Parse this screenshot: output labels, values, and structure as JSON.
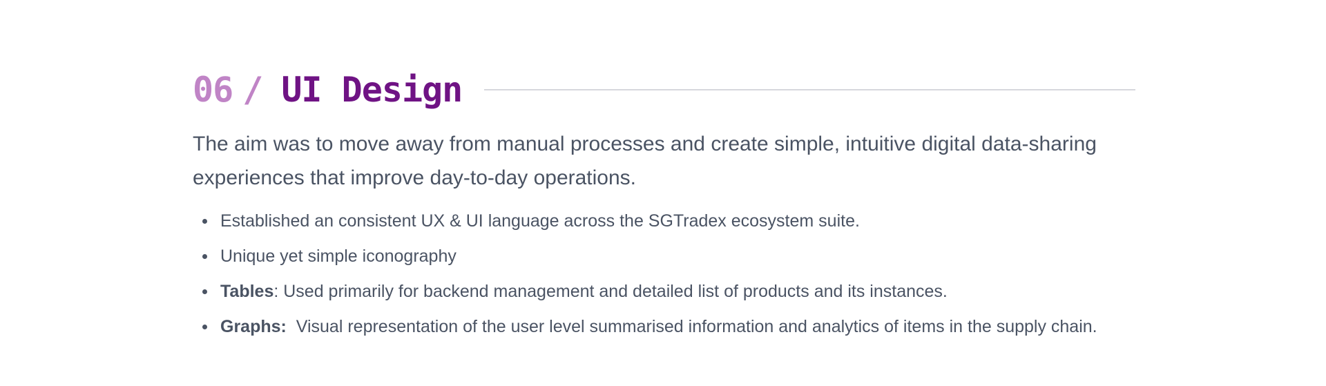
{
  "section": {
    "number": "06",
    "separator": "/",
    "title": "UI Design",
    "intro": "The aim was to move away from manual processes and create simple, intuitive digital data-sharing experiences that improve day-to-day operations.",
    "bullets": [
      {
        "bold": "",
        "text": "Established an consistent UX & UI language across the SGTradex ecosystem suite."
      },
      {
        "bold": "",
        "text": "Unique yet simple iconography"
      },
      {
        "bold": "Tables",
        "text": ": Used primarily for backend management and detailed list of products and its instances."
      },
      {
        "bold": "Graphs:",
        "text": "  Visual representation of the user level summarised information and analytics of items in the supply chain."
      }
    ]
  },
  "colors": {
    "number": "#c084c6",
    "title": "#6f1384",
    "body_text": "#4a5363",
    "rule": "#d6d7dd"
  }
}
